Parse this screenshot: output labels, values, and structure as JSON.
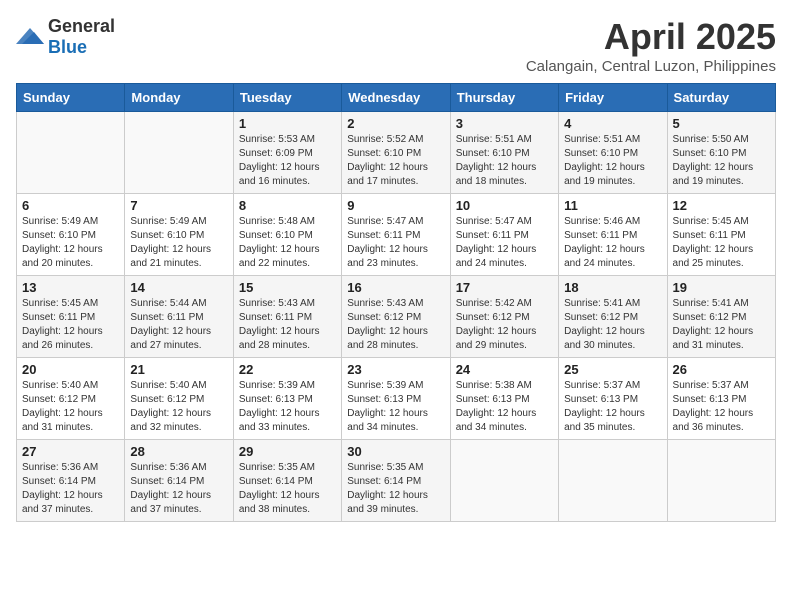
{
  "header": {
    "logo_general": "General",
    "logo_blue": "Blue",
    "title": "April 2025",
    "subtitle": "Calangain, Central Luzon, Philippines"
  },
  "calendar": {
    "days_of_week": [
      "Sunday",
      "Monday",
      "Tuesday",
      "Wednesday",
      "Thursday",
      "Friday",
      "Saturday"
    ],
    "weeks": [
      [
        {
          "day": "",
          "info": ""
        },
        {
          "day": "",
          "info": ""
        },
        {
          "day": "1",
          "info": "Sunrise: 5:53 AM\nSunset: 6:09 PM\nDaylight: 12 hours and 16 minutes."
        },
        {
          "day": "2",
          "info": "Sunrise: 5:52 AM\nSunset: 6:10 PM\nDaylight: 12 hours and 17 minutes."
        },
        {
          "day": "3",
          "info": "Sunrise: 5:51 AM\nSunset: 6:10 PM\nDaylight: 12 hours and 18 minutes."
        },
        {
          "day": "4",
          "info": "Sunrise: 5:51 AM\nSunset: 6:10 PM\nDaylight: 12 hours and 19 minutes."
        },
        {
          "day": "5",
          "info": "Sunrise: 5:50 AM\nSunset: 6:10 PM\nDaylight: 12 hours and 19 minutes."
        }
      ],
      [
        {
          "day": "6",
          "info": "Sunrise: 5:49 AM\nSunset: 6:10 PM\nDaylight: 12 hours and 20 minutes."
        },
        {
          "day": "7",
          "info": "Sunrise: 5:49 AM\nSunset: 6:10 PM\nDaylight: 12 hours and 21 minutes."
        },
        {
          "day": "8",
          "info": "Sunrise: 5:48 AM\nSunset: 6:10 PM\nDaylight: 12 hours and 22 minutes."
        },
        {
          "day": "9",
          "info": "Sunrise: 5:47 AM\nSunset: 6:11 PM\nDaylight: 12 hours and 23 minutes."
        },
        {
          "day": "10",
          "info": "Sunrise: 5:47 AM\nSunset: 6:11 PM\nDaylight: 12 hours and 24 minutes."
        },
        {
          "day": "11",
          "info": "Sunrise: 5:46 AM\nSunset: 6:11 PM\nDaylight: 12 hours and 24 minutes."
        },
        {
          "day": "12",
          "info": "Sunrise: 5:45 AM\nSunset: 6:11 PM\nDaylight: 12 hours and 25 minutes."
        }
      ],
      [
        {
          "day": "13",
          "info": "Sunrise: 5:45 AM\nSunset: 6:11 PM\nDaylight: 12 hours and 26 minutes."
        },
        {
          "day": "14",
          "info": "Sunrise: 5:44 AM\nSunset: 6:11 PM\nDaylight: 12 hours and 27 minutes."
        },
        {
          "day": "15",
          "info": "Sunrise: 5:43 AM\nSunset: 6:11 PM\nDaylight: 12 hours and 28 minutes."
        },
        {
          "day": "16",
          "info": "Sunrise: 5:43 AM\nSunset: 6:12 PM\nDaylight: 12 hours and 28 minutes."
        },
        {
          "day": "17",
          "info": "Sunrise: 5:42 AM\nSunset: 6:12 PM\nDaylight: 12 hours and 29 minutes."
        },
        {
          "day": "18",
          "info": "Sunrise: 5:41 AM\nSunset: 6:12 PM\nDaylight: 12 hours and 30 minutes."
        },
        {
          "day": "19",
          "info": "Sunrise: 5:41 AM\nSunset: 6:12 PM\nDaylight: 12 hours and 31 minutes."
        }
      ],
      [
        {
          "day": "20",
          "info": "Sunrise: 5:40 AM\nSunset: 6:12 PM\nDaylight: 12 hours and 31 minutes."
        },
        {
          "day": "21",
          "info": "Sunrise: 5:40 AM\nSunset: 6:12 PM\nDaylight: 12 hours and 32 minutes."
        },
        {
          "day": "22",
          "info": "Sunrise: 5:39 AM\nSunset: 6:13 PM\nDaylight: 12 hours and 33 minutes."
        },
        {
          "day": "23",
          "info": "Sunrise: 5:39 AM\nSunset: 6:13 PM\nDaylight: 12 hours and 34 minutes."
        },
        {
          "day": "24",
          "info": "Sunrise: 5:38 AM\nSunset: 6:13 PM\nDaylight: 12 hours and 34 minutes."
        },
        {
          "day": "25",
          "info": "Sunrise: 5:37 AM\nSunset: 6:13 PM\nDaylight: 12 hours and 35 minutes."
        },
        {
          "day": "26",
          "info": "Sunrise: 5:37 AM\nSunset: 6:13 PM\nDaylight: 12 hours and 36 minutes."
        }
      ],
      [
        {
          "day": "27",
          "info": "Sunrise: 5:36 AM\nSunset: 6:14 PM\nDaylight: 12 hours and 37 minutes."
        },
        {
          "day": "28",
          "info": "Sunrise: 5:36 AM\nSunset: 6:14 PM\nDaylight: 12 hours and 37 minutes."
        },
        {
          "day": "29",
          "info": "Sunrise: 5:35 AM\nSunset: 6:14 PM\nDaylight: 12 hours and 38 minutes."
        },
        {
          "day": "30",
          "info": "Sunrise: 5:35 AM\nSunset: 6:14 PM\nDaylight: 12 hours and 39 minutes."
        },
        {
          "day": "",
          "info": ""
        },
        {
          "day": "",
          "info": ""
        },
        {
          "day": "",
          "info": ""
        }
      ]
    ]
  }
}
